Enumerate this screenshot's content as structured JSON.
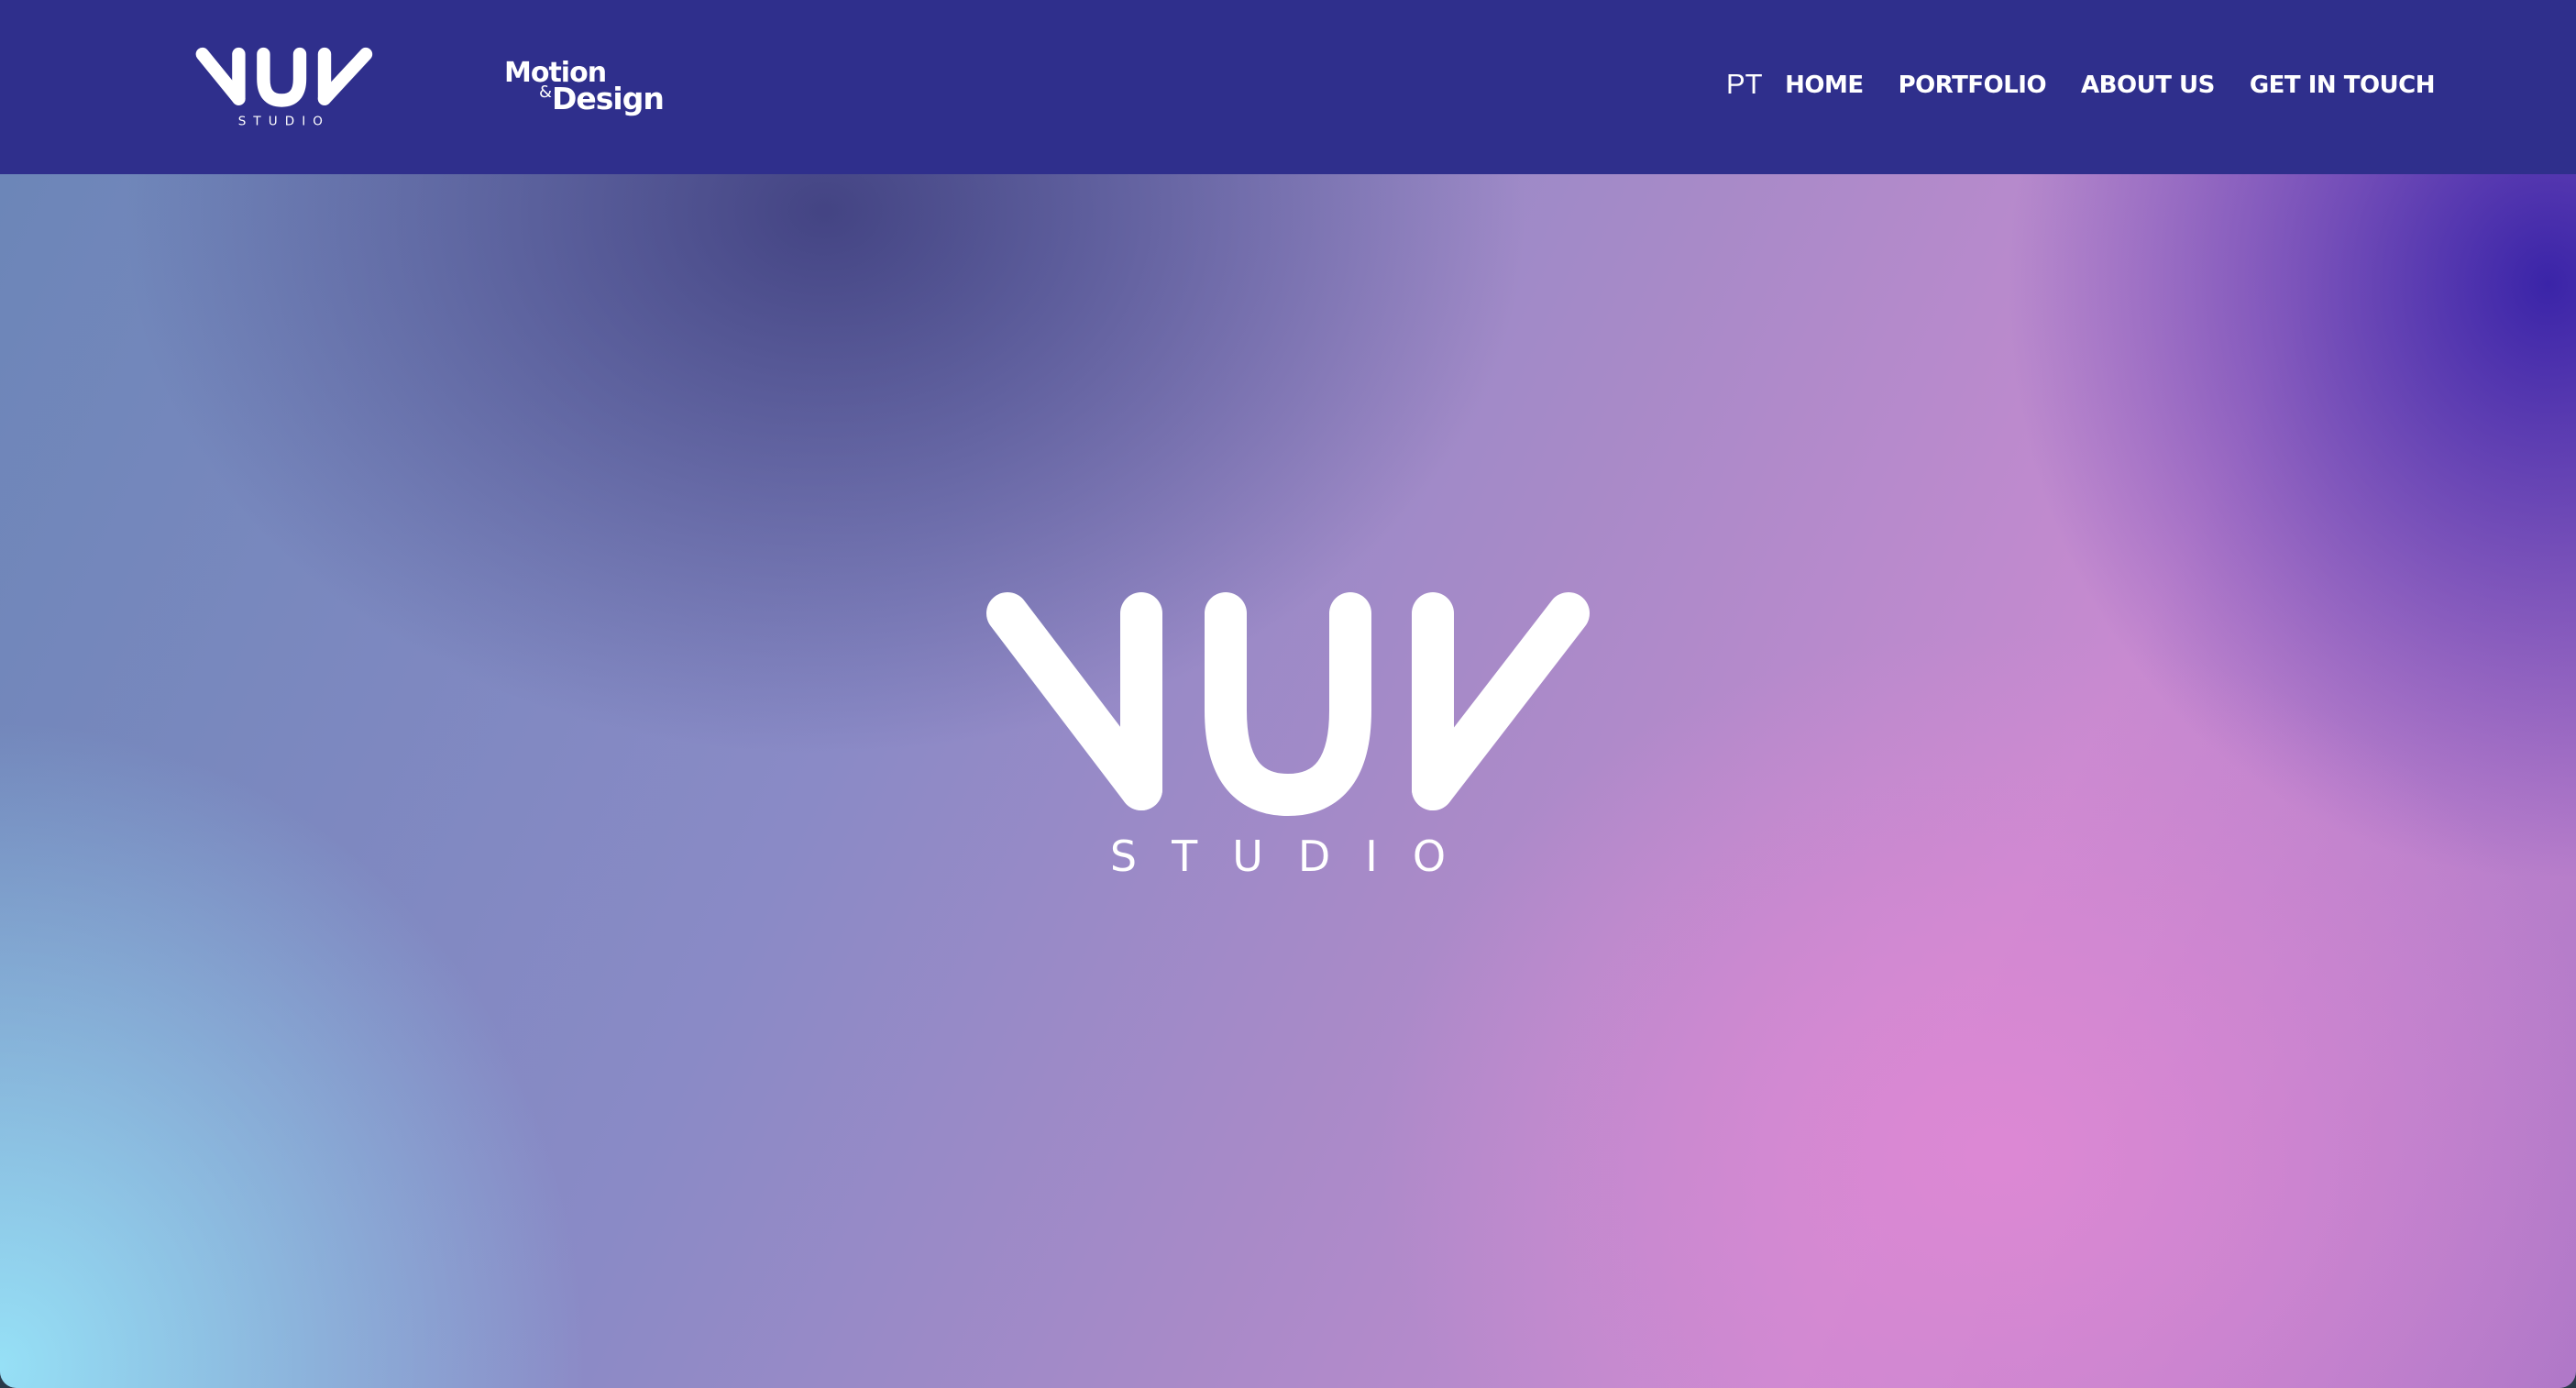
{
  "header": {
    "logo_alt": "NUN STUDIO",
    "logo_wordmark": "NUN",
    "logo_subtitle": "STUDIO",
    "tagline_top": "Motion",
    "tagline_amp": "&",
    "tagline_bottom": "Design",
    "language": "PT",
    "nav": [
      {
        "label": "HOME"
      },
      {
        "label": "PORTFOLIO"
      },
      {
        "label": "ABOUT US"
      },
      {
        "label": "GET IN TOUCH"
      }
    ]
  },
  "hero": {
    "logo_wordmark": "NUN",
    "logo_subtitle": "STUDIO"
  },
  "colors": {
    "header_bg": "#2f2f8c",
    "text": "#ffffff",
    "gradient_pink": "#de88d4",
    "gradient_blue": "#96e0f6",
    "gradient_violet": "#3a24a8"
  }
}
